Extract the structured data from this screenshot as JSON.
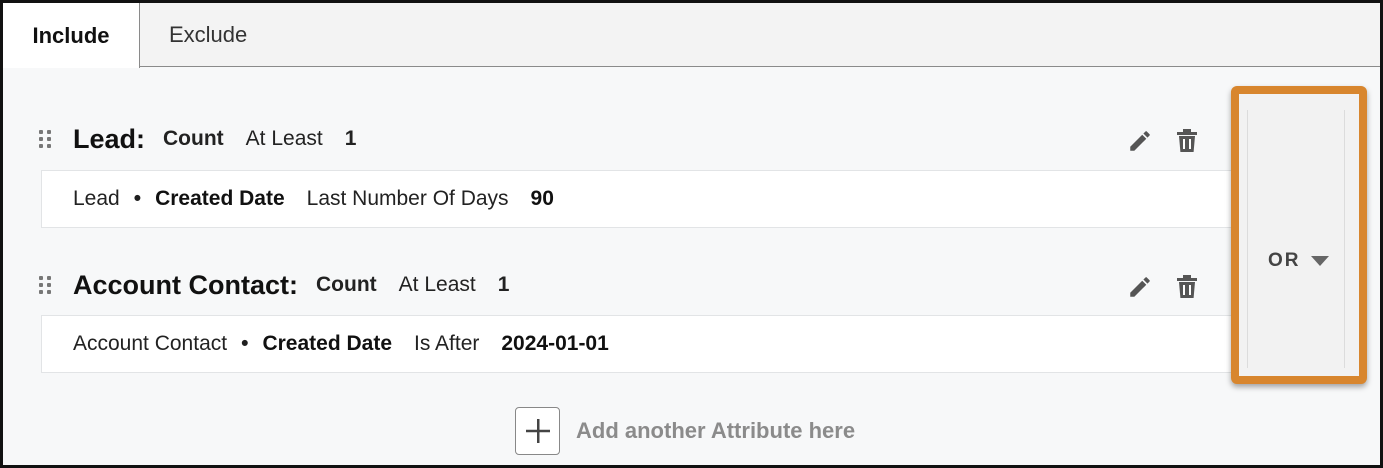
{
  "tabs": [
    {
      "label": "Include",
      "active": true
    },
    {
      "label": "Exclude",
      "active": false
    }
  ],
  "rules": [
    {
      "entity": "Lead:",
      "aggregate": "Count",
      "operator": "At Least",
      "value": "1",
      "detail": {
        "entity": "Lead",
        "bullet": "•",
        "field": "Created Date",
        "condition": "Last Number Of Days",
        "value": "90"
      }
    },
    {
      "entity": "Account Contact:",
      "aggregate": "Count",
      "operator": "At Least",
      "value": "1",
      "detail": {
        "entity": "Account Contact",
        "bullet": "•",
        "field": "Created Date",
        "condition": "Is After",
        "value": "2024-01-01"
      }
    }
  ],
  "connector": {
    "label": "OR",
    "icon": "chevron-down-icon",
    "highlight_color": "#d8862e"
  },
  "icons": {
    "edit": "pencil-icon",
    "delete": "trash-icon",
    "drag": "drag-handle-icon",
    "add": "plus-icon"
  },
  "add_attribute": {
    "label": "Add another Attribute here"
  }
}
